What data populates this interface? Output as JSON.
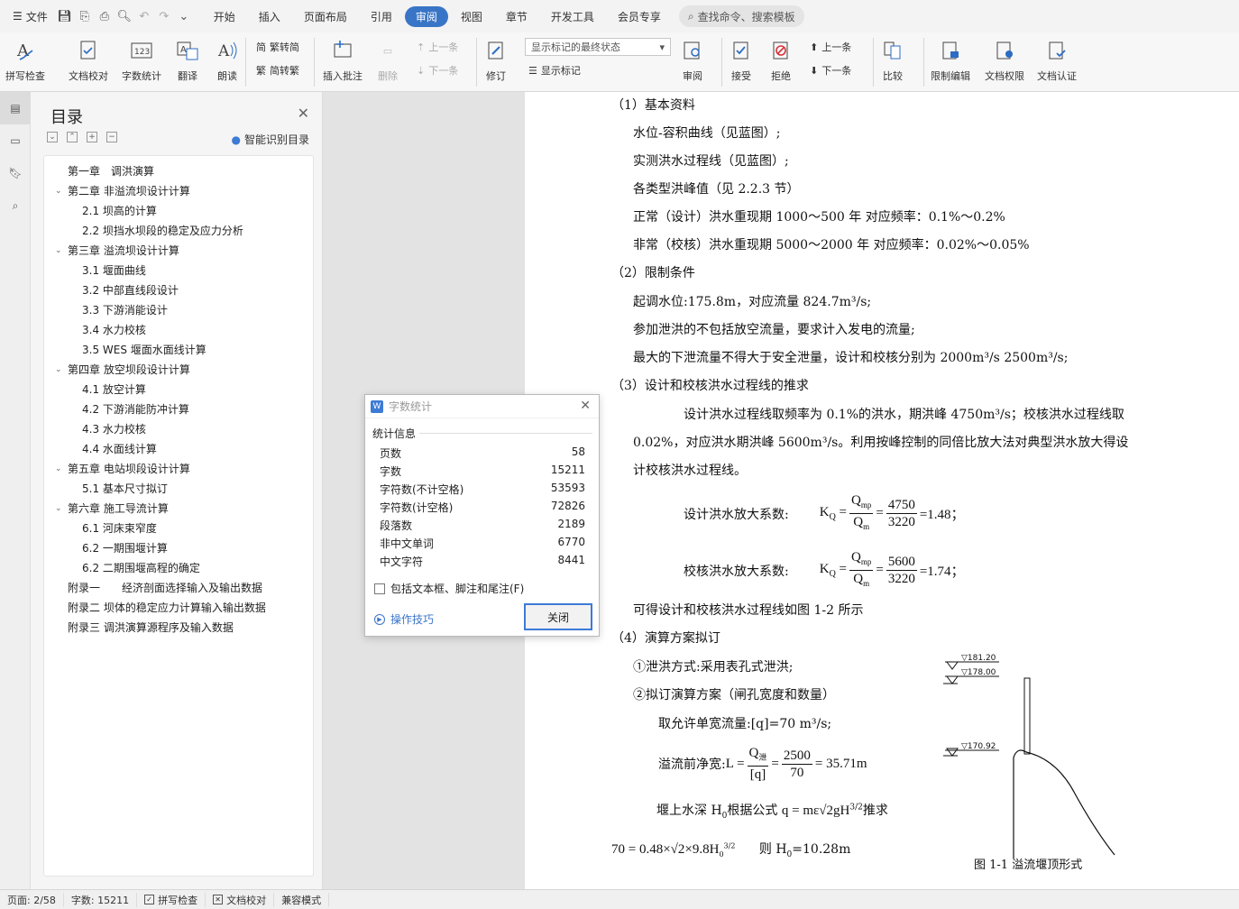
{
  "menubar": {
    "file": "文件",
    "tabs": [
      "开始",
      "插入",
      "页面布局",
      "引用",
      "审阅",
      "视图",
      "章节",
      "开发工具",
      "会员专享"
    ],
    "active_tab": "审阅",
    "search_placeholder": "查找命令、搜索模板"
  },
  "ribbon": {
    "spell": "拼写检查",
    "proof": "文档校对",
    "wordcount": "字数统计",
    "translate": "翻译",
    "read": "朗读",
    "trad": "繁转简",
    "simp": "简转繁",
    "insert_comment": "插入批注",
    "delete": "删除",
    "prev": "上一条",
    "next": "下一条",
    "revise": "修订",
    "markup_select": "显示标记的最终状态",
    "show_markup": "显示标记",
    "review": "审阅",
    "accept": "接受",
    "reject": "拒绝",
    "prev2": "上一条",
    "next2": "下一条",
    "compare": "比较",
    "restrict": "限制编辑",
    "rights": "文档权限",
    "cert": "文档认证"
  },
  "toc": {
    "title": "目录",
    "smart": "智能识别目录",
    "items": [
      {
        "t": "第一章　调洪演算",
        "lv": 1,
        "arrow": false
      },
      {
        "t": "第二章  非溢流坝设计计算",
        "lv": 1,
        "arrow": true
      },
      {
        "t": "2.1  坝高的计算",
        "lv": 2
      },
      {
        "t": "2.2 坝挡水坝段的稳定及应力分析",
        "lv": 2
      },
      {
        "t": "第三章  溢流坝设计计算",
        "lv": 1,
        "arrow": true
      },
      {
        "t": "3.1 堰面曲线",
        "lv": 2
      },
      {
        "t": "3.2  中部直线段设计",
        "lv": 2
      },
      {
        "t": "3.3 下游消能设计",
        "lv": 2
      },
      {
        "t": "3.4  水力校核",
        "lv": 2
      },
      {
        "t": "3.5 WES 堰面水面线计算",
        "lv": 2
      },
      {
        "t": "第四章  放空坝段设计计算",
        "lv": 1,
        "arrow": true
      },
      {
        "t": "4.1  放空计算",
        "lv": 2
      },
      {
        "t": "4.2  下游消能防冲计算",
        "lv": 2
      },
      {
        "t": "4.3  水力校核",
        "lv": 2
      },
      {
        "t": "4.4  水面线计算",
        "lv": 2
      },
      {
        "t": "第五章  电站坝段设计计算",
        "lv": 1,
        "arrow": true
      },
      {
        "t": "5.1  基本尺寸拟订",
        "lv": 2
      },
      {
        "t": "第六章  施工导流计算",
        "lv": 1,
        "arrow": true
      },
      {
        "t": "6.1 河床束窄度",
        "lv": 2
      },
      {
        "t": "6.2 一期围堰计算",
        "lv": 2
      },
      {
        "t": "6.2 二期围堰高程的确定",
        "lv": 2
      },
      {
        "t": "附录一　　经济剖面选择输入及输出数据",
        "lv": 1,
        "arrow": false
      },
      {
        "t": "附录二  坝体的稳定应力计算输入输出数据",
        "lv": 1,
        "arrow": false
      },
      {
        "t": "附录三  调洪演算源程序及输入数据",
        "lv": 1,
        "arrow": false
      }
    ]
  },
  "doc": {
    "l1": "（1）基本资料",
    "l2": "水位-容积曲线（见蓝图）;",
    "l3": "实测洪水过程线（见蓝图）;",
    "l4": "各类型洪峰值（见 2.2.3 节）",
    "l5": "正常（设计）洪水重现期  1000～500 年  对应频率：0.1%～0.2%",
    "l6": "非常（校核）洪水重现期  5000～2000 年  对应频率：0.02%～0.05%",
    "l7": "（2）限制条件",
    "l8": "起调水位:175.8m，对应流量 824.7m³/s;",
    "l9": "参加泄洪的不包括放空流量，要求计入发电的流量;",
    "l10": "最大的下泄流量不得大于安全泄量，设计和校核分别为 2000m³/s  2500m³/s;",
    "l11": "（3）设计和校核洪水过程线的推求",
    "l12": "设计洪水过程线取频率为 0.1%的洪水，期洪峰 4750m³/s；校核洪水过程线取",
    "l13": "0.02%，对应洪水期洪峰 5600m³/s。利用按峰控制的同倍比放大法对典型洪水放大得设",
    "l14": "计校核洪水过程线。",
    "f1_label": "设计洪水放大系数:",
    "f1_k": "K",
    "f1_sub": "Q",
    "f1_num": "Q",
    "f1_num_sub": "mp",
    "f1_den": "Q",
    "f1_den_sub": "m",
    "f1_n2": "4750",
    "f1_d2": "3220",
    "f1_res": "=1.48；",
    "f2_label": "校核洪水放大系数:",
    "f2_n2": "5600",
    "f2_d2": "3220",
    "f2_res": "=1.74；",
    "l15": "可得设计和校核洪水过程线如图 1-2 所示",
    "l16": "（4）演算方案拟订",
    "l17": "①泄洪方式:采用表孔式泄洪;",
    "l18": "②拟订演算方案（闸孔宽度和数量）",
    "l19": "取允许单宽流量:[q]=70  m³/s;",
    "f3_label": "溢流前净宽:",
    "f3_L": "L =",
    "f3_num": "Q",
    "f3_num_sub": "泄",
    "f3_den": "[q]",
    "f3_n2": "2500",
    "f3_d2": "70",
    "f3_res": "= 35.71m",
    "l20a": "堰上水深 H",
    "l20b": "根据公式",
    "l20c": "q = mε√2gH",
    "l20d": "3/2",
    "l20e": "推求",
    "l21a": "70 = 0.48×√2×9.8H",
    "l21b": "3/2",
    "l21c": "则 H",
    "l21d": "=10.28m",
    "fig_l1": "▽181.20",
    "fig_l2": "▽178.00",
    "fig_l3": "▽170.92",
    "fig_caption": "图 1-1 溢流堰顶形式"
  },
  "dialog": {
    "title": "字数统计",
    "section": "统计信息",
    "rows": [
      {
        "k": "页数",
        "v": "58"
      },
      {
        "k": "字数",
        "v": "15211"
      },
      {
        "k": "字符数(不计空格)",
        "v": "53593"
      },
      {
        "k": "字符数(计空格)",
        "v": "72826"
      },
      {
        "k": "段落数",
        "v": "2189"
      },
      {
        "k": "非中文单词",
        "v": "6770"
      },
      {
        "k": "中文字符",
        "v": "8441"
      }
    ],
    "checkbox": "包括文本框、脚注和尾注(F)",
    "tips": "操作技巧",
    "close": "关闭"
  },
  "status": {
    "page": "页面: 2/58",
    "words": "字数: 15211",
    "spell": "拼写检查",
    "proof": "文档校对",
    "compat": "兼容模式"
  }
}
